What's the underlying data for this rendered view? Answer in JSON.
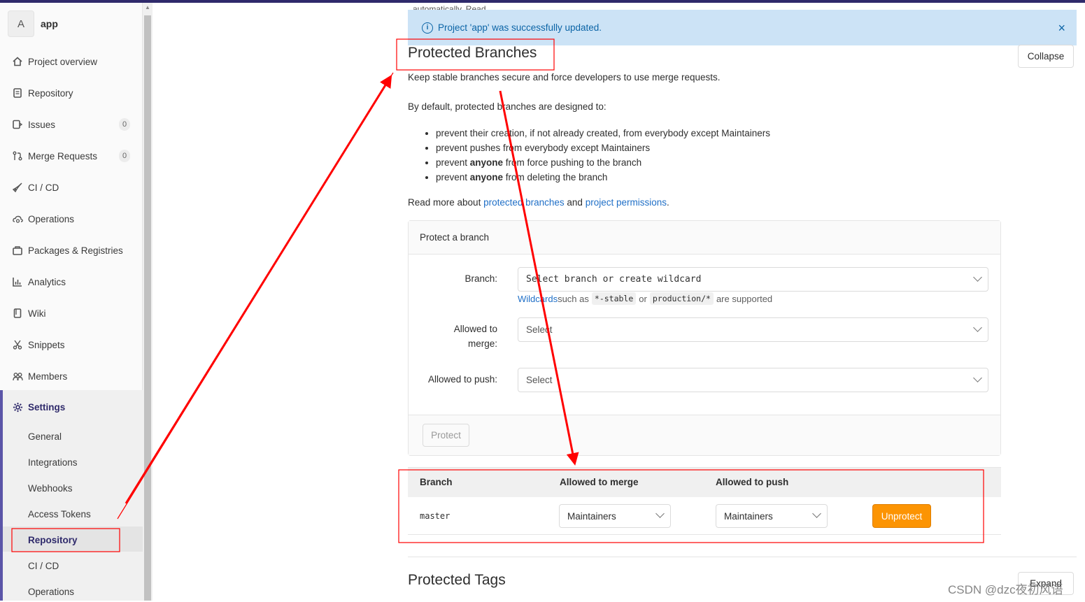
{
  "project": {
    "avatar_letter": "A",
    "name": "app"
  },
  "sidebar": {
    "items": [
      {
        "label": "Project overview",
        "icon": "home-icon"
      },
      {
        "label": "Repository",
        "icon": "document-icon"
      },
      {
        "label": "Issues",
        "icon": "issues-icon",
        "count": "0"
      },
      {
        "label": "Merge Requests",
        "icon": "merge-request-icon",
        "count": "0"
      },
      {
        "label": "CI / CD",
        "icon": "rocket-icon"
      },
      {
        "label": "Operations",
        "icon": "cloud-gear-icon"
      },
      {
        "label": "Packages & Registries",
        "icon": "package-icon"
      },
      {
        "label": "Analytics",
        "icon": "chart-icon"
      },
      {
        "label": "Wiki",
        "icon": "book-icon"
      },
      {
        "label": "Snippets",
        "icon": "scissors-icon"
      },
      {
        "label": "Members",
        "icon": "users-icon"
      }
    ],
    "settings": {
      "label": "Settings",
      "icon": "gear-icon",
      "subitems": [
        "General",
        "Integrations",
        "Webhooks",
        "Access Tokens",
        "Repository",
        "CI / CD",
        "Operations"
      ],
      "active": "Repository"
    }
  },
  "flash": {
    "message": "Project 'app' was successfully updated.",
    "close": "×"
  },
  "cut_text": "automatically. Read",
  "section": {
    "title": "Protected Branches",
    "collapse_label": "Collapse",
    "intro": "Keep stable branches secure and force developers to use merge requests.",
    "default_text": "By default, protected branches are designed to:",
    "rules": [
      {
        "pre": "prevent their creation, if not already created, from everybody except Maintainers",
        "bold": "",
        "post": ""
      },
      {
        "pre": "prevent pushes from everybody except Maintainers",
        "bold": "",
        "post": ""
      },
      {
        "pre": "prevent ",
        "bold": "anyone",
        "post": " from force pushing to the branch"
      },
      {
        "pre": "prevent ",
        "bold": "anyone",
        "post": " from deleting the branch"
      }
    ],
    "read_more_pre": "Read more about ",
    "link1": "protected branches",
    "read_more_mid": " and ",
    "link2": "project permissions",
    "read_more_post": "."
  },
  "form": {
    "header": "Protect a branch",
    "branch_label": "Branch:",
    "branch_placeholder": "Select branch or create wildcard",
    "help_link": "Wildcards",
    "help_mid": " such as ",
    "code1": "*-stable",
    "help_or": " or ",
    "code2": "production/*",
    "help_post": " are supported",
    "merge_label": "Allowed to merge:",
    "merge_placeholder": "Select",
    "push_label": "Allowed to push:",
    "push_placeholder": "Select",
    "protect_button": "Protect"
  },
  "table": {
    "headers": [
      "Branch",
      "Allowed to merge",
      "Allowed to push"
    ],
    "rows": [
      {
        "branch": "master",
        "merge": "Maintainers",
        "push": "Maintainers",
        "action": "Unprotect"
      }
    ]
  },
  "tags_section": {
    "title": "Protected Tags",
    "expand_label": "Expand"
  },
  "watermark": "CSDN @dzc夜初风语",
  "colors": {
    "brand": "#2f2a6b",
    "link": "#1f6fc7",
    "unprotect": "#fc9403",
    "annotation": "#ff0000",
    "flash_bg": "#cce3f6"
  }
}
